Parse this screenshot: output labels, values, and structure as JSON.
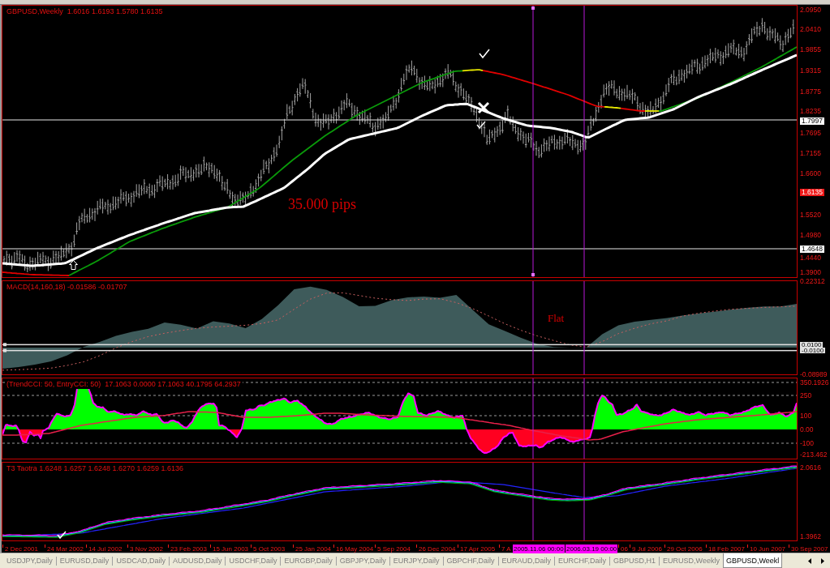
{
  "chart": {
    "panels": [
      {
        "kind": "price",
        "header": "GBPUSD,Weekly  1.6016 1.6193 1.5780 1.6135",
        "notes": [
          "35.000 pips"
        ],
        "axis": [
          {
            "text": "2.0950",
            "kind": "tick"
          },
          {
            "text": "2.0410",
            "kind": "tick"
          },
          {
            "text": "1.9855",
            "kind": "tick"
          },
          {
            "text": "1.9315",
            "kind": "tick"
          },
          {
            "text": "1.8775",
            "kind": "tick"
          },
          {
            "text": "1.8235",
            "kind": "tick"
          },
          {
            "text": "1.7997",
            "kind": "line"
          },
          {
            "text": "1.7695",
            "kind": "tick"
          },
          {
            "text": "1.7155",
            "kind": "tick"
          },
          {
            "text": "1.6600",
            "kind": "tick"
          },
          {
            "text": "1.6135",
            "kind": "price"
          },
          {
            "text": "1.5520",
            "kind": "tick"
          },
          {
            "text": "1.4980",
            "kind": "tick"
          },
          {
            "text": "1.4648",
            "kind": "line"
          },
          {
            "text": "1.4440",
            "kind": "tick"
          },
          {
            "text": "1.3900",
            "kind": "tick"
          }
        ]
      },
      {
        "kind": "macd",
        "header": "MACD(14,160,18) -0.01586 -0.01707",
        "notes": [
          "Flat"
        ],
        "chart_data": {
          "type": "line",
          "ylim": [
            -0.08989,
            0.22312
          ],
          "yticks": [
            {
              "value": 0.22312,
              "label": "0.22312"
            },
            {
              "value": 0.01,
              "label": "0.0100"
            },
            {
              "value": -0.01,
              "label": "-0.0100"
            },
            {
              "value": -0.08989,
              "label": "-0.08989"
            }
          ],
          "ref_lines": [
            {
              "axis": "y",
              "value": 0.01,
              "color": "#e0e0e0"
            },
            {
              "axis": "y",
              "value": -0.01,
              "color": "#e0e0e0"
            }
          ],
          "series": [
            {
              "type": "area",
              "color": "#3e5b5b",
              "values": [
                -0.071,
                -0.065,
                -0.057,
                -0.046,
                -0.026,
                0.002,
                0.019,
                0.039,
                0.053,
                0.063,
                0.084,
                0.077,
                0.064,
                0.088,
                0.081,
                0.065,
                0.096,
                0.142,
                0.196,
                0.205,
                0.194,
                0.17,
                0.139,
                0.14,
                0.159,
                0.169,
                0.171,
                0.167,
                0.177,
                0.127,
                0.078,
                0.056,
                0.033,
                0.012,
                0.002,
                0.0,
                -0.001,
                0.045,
                0.075,
                0.087,
                0.093,
                0.099,
                0.108,
                0.115,
                0.121,
                0.128,
                0.134,
                0.138,
                0.138,
                0.147
              ]
            },
            {
              "type": "line",
              "color": "#c86060",
              "line_style": "dashed",
              "values": [
                -0.076,
                -0.074,
                -0.072,
                -0.069,
                -0.06,
                -0.048,
                -0.027,
                -0.001,
                0.02,
                0.037,
                0.048,
                0.057,
                0.065,
                0.069,
                0.072,
                0.075,
                0.081,
                0.093,
                0.129,
                0.163,
                0.183,
                0.184,
                0.175,
                0.166,
                0.161,
                0.158,
                0.163,
                0.164,
                0.151,
                0.131,
                0.106,
                0.08,
                0.058,
                0.039,
                0.024,
                0.009,
                0.002,
                0.02,
                0.047,
                0.065,
                0.08,
                0.09,
                0.106,
                0.116,
                0.123,
                0.129,
                0.132,
                0.135,
                0.137,
                0.139
              ]
            }
          ]
        }
      },
      {
        "kind": "cci",
        "header": "(TrendCCI: 50, EntryCCI: 50)  17.1063 0.0000 17.1063 40.1795 64.2937",
        "axis": [
          {
            "text": "350.1926",
            "kind": "tick"
          },
          {
            "text": "250",
            "kind": "tick"
          },
          {
            "text": "100",
            "kind": "tick"
          },
          {
            "text": "0.00",
            "kind": "tick"
          },
          {
            "text": "-100",
            "kind": "tick"
          },
          {
            "text": "-213.462",
            "kind": "tick"
          }
        ]
      },
      {
        "kind": "t3",
        "header": "T3 Taotra 1.6248 1.6257 1.6248 1.6270 1.6259 1.6136",
        "axis": [
          {
            "text": "2.0616",
            "kind": "tick"
          },
          {
            "text": "1.3962",
            "kind": "tick"
          }
        ]
      }
    ],
    "time_axis": [
      {
        "text": "2 Dec 2001",
        "kind": "date"
      },
      {
        "text": "24 Mar 2002",
        "kind": "date"
      },
      {
        "text": "14 Jul 2002",
        "kind": "date"
      },
      {
        "text": "3 Nov 2002",
        "kind": "date"
      },
      {
        "text": "23 Feb 2003",
        "kind": "date"
      },
      {
        "text": "15 Jun 2003",
        "kind": "date"
      },
      {
        "text": "5 Oct 2003",
        "kind": "date"
      },
      {
        "text": "25 Jan 2004",
        "kind": "date"
      },
      {
        "text": "16 May 2004",
        "kind": "date"
      },
      {
        "text": "5 Sep 2004",
        "kind": "date"
      },
      {
        "text": "26 Dec 2004",
        "kind": "date"
      },
      {
        "text": "17 Apr 2005",
        "kind": "date"
      },
      {
        "text": "7 A",
        "kind": "date"
      },
      {
        "text": "2005.11.06 00:00",
        "kind": "cursor"
      },
      {
        "text": "2006.03.19 00:00",
        "kind": "cursor"
      },
      {
        "text": "06",
        "kind": "date"
      },
      {
        "text": "9 Jul 2006",
        "kind": "date"
      },
      {
        "text": "29 Oct 2006",
        "kind": "date"
      },
      {
        "text": "18 Feb 2007",
        "kind": "date"
      },
      {
        "text": "10 Jun 2007",
        "kind": "date"
      },
      {
        "text": "30 Sep 2007",
        "kind": "date"
      }
    ]
  },
  "tabs": [
    {
      "label": "USDJPY,Daily",
      "selected": false
    },
    {
      "label": "EURUSD,Daily",
      "selected": false
    },
    {
      "label": "USDCAD,Daily",
      "selected": false
    },
    {
      "label": "AUDUSD,Daily",
      "selected": false
    },
    {
      "label": "USDCHF,Daily",
      "selected": false
    },
    {
      "label": "EURGBP,Daily",
      "selected": false
    },
    {
      "label": "GBPJPY,Daily",
      "selected": false
    },
    {
      "label": "EURJPY,Daily",
      "selected": false
    },
    {
      "label": "GBPCHF,Daily",
      "selected": false
    },
    {
      "label": "EURAUD,Daily",
      "selected": false
    },
    {
      "label": "EURCHF,Daily",
      "selected": false
    },
    {
      "label": "GBPUSD,H1",
      "selected": false
    },
    {
      "label": "EURUSD,Weekly",
      "selected": false
    },
    {
      "label": "GBPUSD,Weekl",
      "selected": true
    }
  ]
}
